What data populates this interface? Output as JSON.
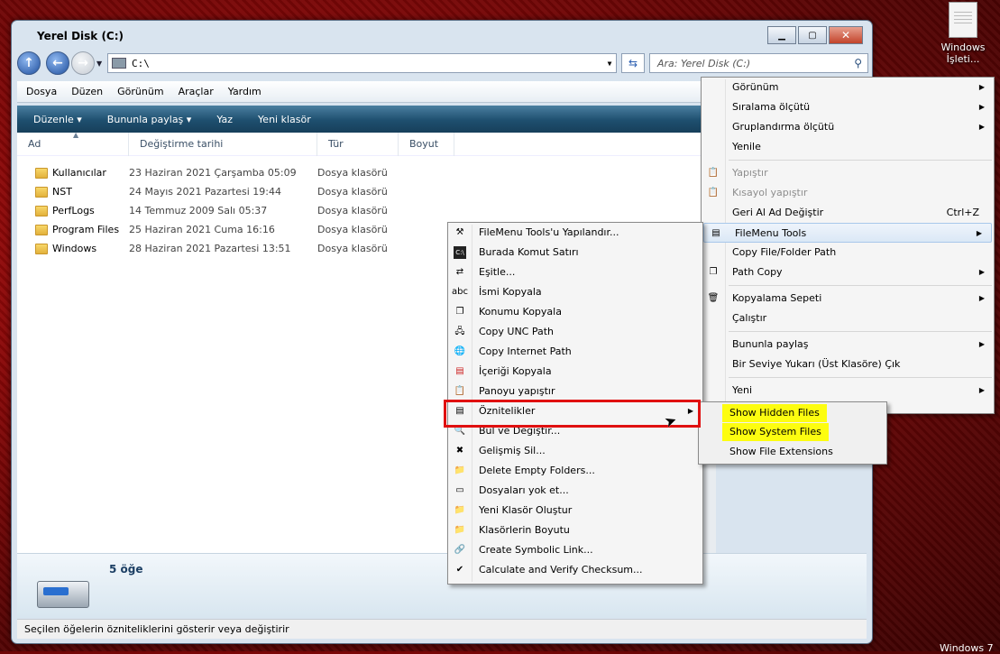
{
  "desktop": {
    "icon_label_line1": "Windows",
    "icon_label_line2": "İşleti...",
    "corner_text": "Windows 7"
  },
  "window": {
    "title": "Yerel Disk (C:)",
    "address": "C:\\",
    "search_placeholder": "Ara: Yerel Disk (C:)"
  },
  "menubar": [
    "Dosya",
    "Düzen",
    "Görünüm",
    "Araçlar",
    "Yardım"
  ],
  "toolbar": [
    "Düzenle ▾",
    "Bununla paylaş ▾",
    "Yaz",
    "Yeni klasör"
  ],
  "columns": [
    "Ad",
    "Değiştirme tarihi",
    "Tür",
    "Boyut"
  ],
  "files": [
    {
      "name": "Kullanıcılar",
      "date": "23 Haziran 2021 Çarşamba 05:09",
      "type": "Dosya klasörü"
    },
    {
      "name": "NST",
      "date": "24 Mayıs 2021 Pazartesi 19:44",
      "type": "Dosya klasörü"
    },
    {
      "name": "PerfLogs",
      "date": "14 Temmuz 2009 Salı 05:37",
      "type": "Dosya klasörü"
    },
    {
      "name": "Program Files",
      "date": "25 Haziran 2021 Cuma 16:16",
      "type": "Dosya klasörü"
    },
    {
      "name": "Windows",
      "date": "28 Haziran 2021 Pazartesi 13:51",
      "type": "Dosya klasörü"
    }
  ],
  "details": {
    "count": "5 öğe"
  },
  "status": "Seçilen öğelerin özniteliklerini gösterir veya değiştirir",
  "context_menu": {
    "items": [
      {
        "label": "Görünüm",
        "arrow": "▶"
      },
      {
        "label": "Sıralama ölçütü",
        "arrow": "▶"
      },
      {
        "label": "Gruplandırma ölçütü",
        "arrow": "▶"
      },
      {
        "label": "Yenile"
      },
      {
        "label": "Yapıştır"
      },
      {
        "label": "Kısayol yapıştır"
      },
      {
        "label": "Geri Al Ad Değiştir",
        "shortcut": "Ctrl+Z"
      },
      {
        "label": "FileMenu Tools",
        "arrow": "▶"
      },
      {
        "label": "Copy File/Folder Path"
      },
      {
        "label": "Path Copy",
        "arrow": "▶"
      },
      {
        "label": "Kopyalama Sepeti",
        "arrow": "▶"
      },
      {
        "label": "Çalıştır"
      },
      {
        "label": "Bununla paylaş",
        "arrow": "▶"
      },
      {
        "label": "Bir Seviye Yukarı (Üst Klasöre) Çık"
      },
      {
        "label": "Yeni",
        "arrow": "▶"
      }
    ]
  },
  "filemenu_tools": {
    "items": [
      "FileMenu Tools'u Yapılandır...",
      "Burada Komut Satırı",
      "Eşitle...",
      "İsmi Kopyala",
      "Konumu Kopyala",
      "Copy UNC Path",
      "Copy Internet Path",
      "İçeriği Kopyala",
      "Panoyu yapıştır",
      "Öznitelikler",
      "Bul ve Değiştir...",
      "Gelişmiş Sil...",
      "Delete Empty Folders...",
      "Dosyaları yok et...",
      "Yeni Klasör Oluştur",
      "Klasörlerin Boyutu",
      "Create Symbolic Link...",
      "Calculate and Verify Checksum..."
    ]
  },
  "attributes_menu": {
    "items": [
      "Show Hidden Files",
      "Show System Files",
      "Show File Extensions"
    ]
  }
}
